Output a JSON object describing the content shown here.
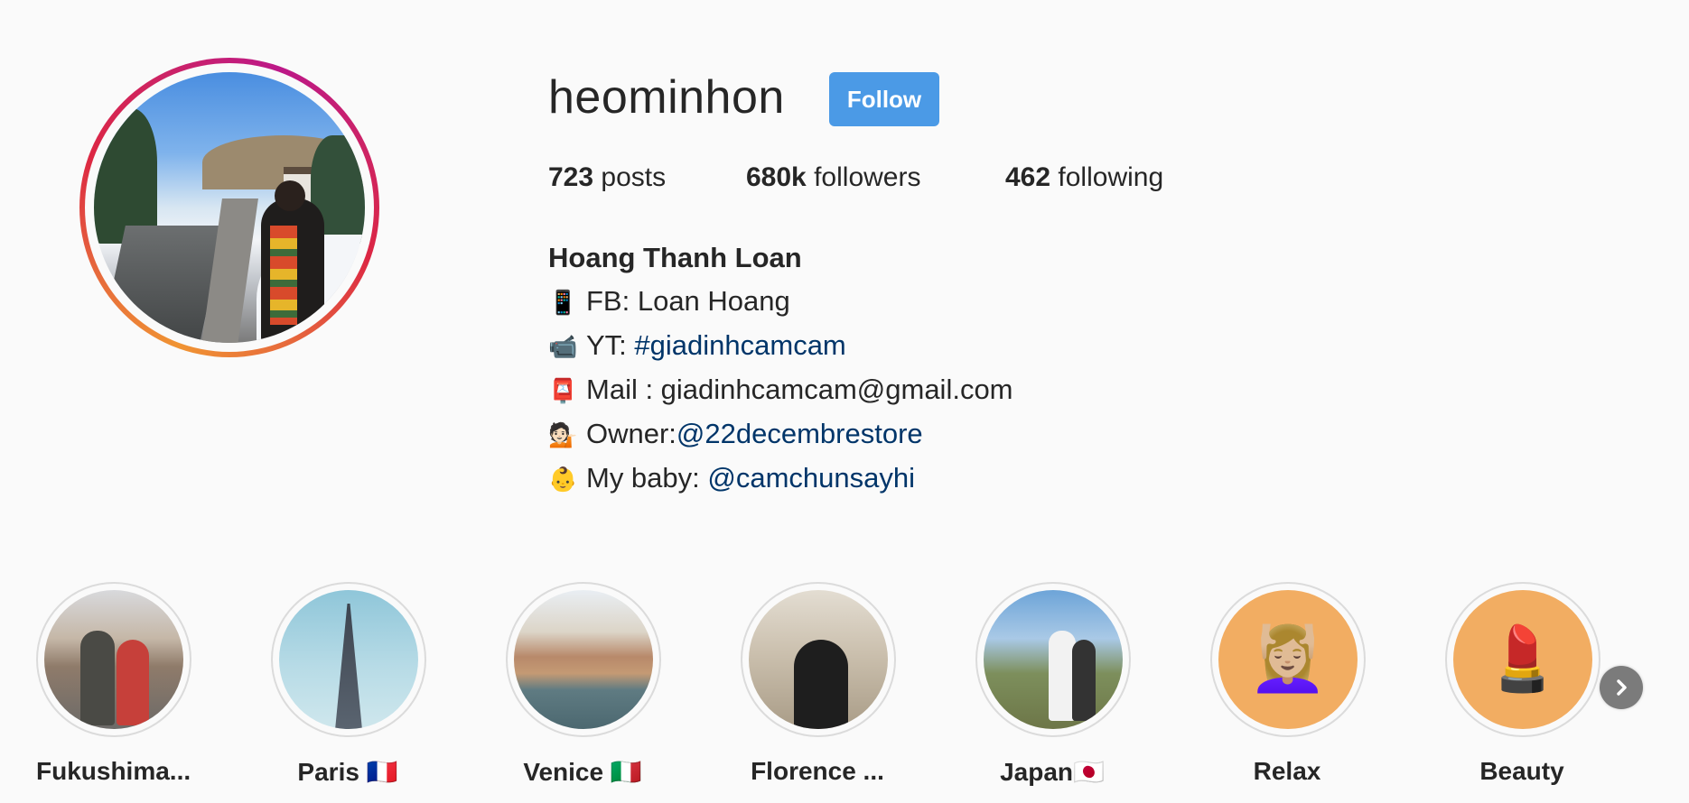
{
  "profile": {
    "username": "heominhon",
    "follow_label": "Follow",
    "stats": {
      "posts_count": "723",
      "posts_label": "posts",
      "followers_count": "680k",
      "followers_label": "followers",
      "following_count": "462",
      "following_label": "following"
    },
    "bio": {
      "full_name": "Hoang Thanh Loan",
      "lines": [
        {
          "emoji": "📱",
          "text": "FB: Loan Hoang",
          "link": ""
        },
        {
          "emoji": "📹",
          "text": "YT: ",
          "link": "#giadinhcamcam"
        },
        {
          "emoji": "📮",
          "text": "Mail : giadinhcamcam@gmail.com",
          "link": ""
        },
        {
          "emoji": "💁🏻",
          "text": "Owner:",
          "link": "@22decembrestore"
        },
        {
          "emoji": "👶",
          "text": "My baby: ",
          "link": "@camchunsayhi"
        }
      ]
    }
  },
  "highlights": [
    {
      "label": "Fukushima...",
      "emoji": ""
    },
    {
      "label": "Paris 🇫🇷",
      "emoji": ""
    },
    {
      "label": "Venice 🇮🇹",
      "emoji": ""
    },
    {
      "label": "Florence ...",
      "emoji": ""
    },
    {
      "label": "Japan🇯🇵",
      "emoji": ""
    },
    {
      "label": "Relax",
      "emoji": "💆🏼‍♀️"
    },
    {
      "label": "Beauty",
      "emoji": "💄"
    }
  ],
  "icons": {
    "next": "chevron-right-icon"
  },
  "colors": {
    "follow_button": "#4b9ae6",
    "link": "#003569",
    "highlight_bg": "#f2ad62"
  }
}
